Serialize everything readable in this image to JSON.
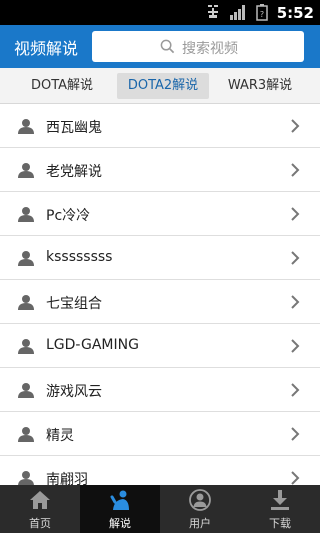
{
  "status_bar": {
    "time": "5:52"
  },
  "header": {
    "title": "视频解说",
    "search_placeholder": "搜索视频"
  },
  "tabs": [
    {
      "label": "DOTA解说",
      "active": false
    },
    {
      "label": "DOTA2解说",
      "active": true
    },
    {
      "label": "WAR3解说",
      "active": false
    }
  ],
  "list": {
    "items": [
      {
        "label": "西瓦幽鬼"
      },
      {
        "label": "老党解说"
      },
      {
        "label": "Pc冷冷"
      },
      {
        "label": "kssssssss"
      },
      {
        "label": "七宝组合"
      },
      {
        "label": "LGD-GAMING"
      },
      {
        "label": "游戏风云"
      },
      {
        "label": "精灵"
      },
      {
        "label": "南翩羽"
      }
    ]
  },
  "bottom_nav": {
    "items": [
      {
        "label": "首页",
        "icon": "home-icon",
        "active": false
      },
      {
        "label": "解说",
        "icon": "commentator-icon",
        "active": true
      },
      {
        "label": "用户",
        "icon": "user-icon",
        "active": false
      },
      {
        "label": "下载",
        "icon": "download-icon",
        "active": false
      }
    ]
  },
  "colors": {
    "header": "#1a78c9",
    "active_tab_text": "#1a66aa",
    "nav_bg": "#2b2b2b"
  }
}
